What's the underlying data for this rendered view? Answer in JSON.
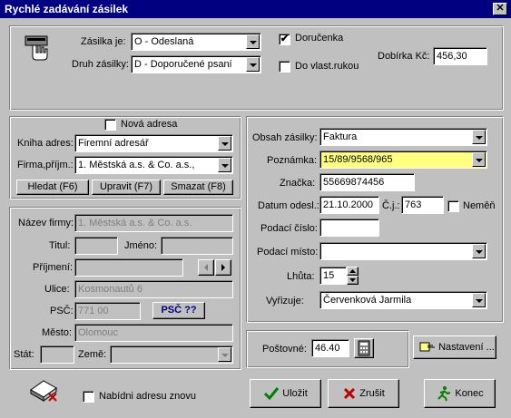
{
  "window": {
    "title": "Rychlé zadávání zásilek",
    "close": "✕"
  },
  "top": {
    "zasilka_label": "Zásilka je:",
    "zasilka_value": "O - Odeslaná",
    "druh_label": "Druh zásilky:",
    "druh_value": "D - Doporučené psaní",
    "dorucenka_label": "Doručenka",
    "dorucenka_checked": "✔",
    "do_vlast_label": "Do vlast.rukou",
    "dobirka_label": "Dobírka Kč:",
    "dobirka_value": "456,30"
  },
  "address_source": {
    "nova_adresa_label": "Nová adresa",
    "kniha_label": "Kniha adres:",
    "kniha_value": "Firemní adresář",
    "firma_label": "Firma,příjm.:",
    "firma_value": "1. Městská a.s. & Co. a.s.,",
    "hledat": "Hledat (F6)",
    "upravit": "Upravit (F7)",
    "smazat": "Smazat (F8)"
  },
  "address": {
    "nazev_label": "Název firmy:",
    "nazev_value": "1. Městská a.s. & Co. a.s.",
    "titul_label": "Titul:",
    "jmeno_label": "Jméno:",
    "prijmeni_label": "Příjmení:",
    "ulice_label": "Ulice:",
    "ulice_value": "Kosmonautů 6",
    "psc_label": "PSČ:",
    "psc_value": "771 00",
    "psc_button": "PSČ ??",
    "mesto_label": "Město:",
    "mesto_value": "Olomouc",
    "stat_label": "Stát:",
    "zeme_label": "Země:",
    "nabidni_label": "Nabídni adresu znovu"
  },
  "details": {
    "obsah_label": "Obsah zásilky:",
    "obsah_value": "Faktura",
    "poznamka_label": "Poznámka:",
    "poznamka_value": "15/89/9568/965",
    "znacka_label": "Značka:",
    "znacka_value": "55669874456",
    "datum_label": "Datum odesl.:",
    "datum_value": "21.10.2000",
    "cj_label": "Č.j.:",
    "cj_value": "763",
    "nemen_label": "Neměň",
    "podaci_cislo_label": "Podací číslo:",
    "podaci_misto_label": "Podací místo:",
    "lhuta_label": "Lhůta:",
    "lhuta_value": "15",
    "vyrizuje_label": "Vyřizuje:",
    "vyrizuje_value": "Červenková Jarmila"
  },
  "bottom": {
    "postovne_label": "Poštovné:",
    "postovne_value": "46.40",
    "nastaveni": "Nastavení ...",
    "ulozit": "Uložit",
    "zrusit": "Zrušit",
    "konec": "Konec"
  },
  "icons": [
    "hand-card-icon",
    "calculator-icon",
    "settings-hand-icon",
    "checkmark-icon",
    "x-icon",
    "running-man-icon",
    "address-book-eraser-icon"
  ],
  "colors": {
    "title_bar": "#000080",
    "highlight": "#ffff80",
    "dialog": "#c0c0c0",
    "psc_text": "#000080"
  }
}
